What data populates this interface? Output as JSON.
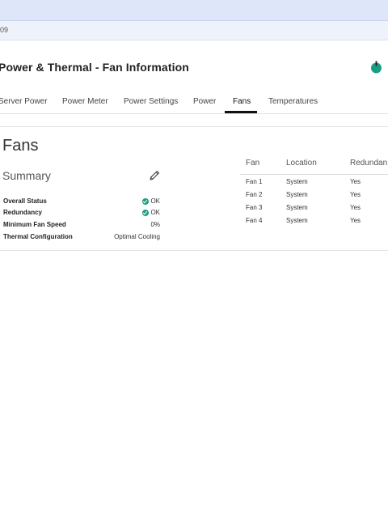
{
  "breadcrumb": {
    "text": "09"
  },
  "page": {
    "title": "Power & Thermal - Fan Information"
  },
  "tabs": [
    {
      "label": "Server Power"
    },
    {
      "label": "Power Meter"
    },
    {
      "label": "Power Settings"
    },
    {
      "label": "Power"
    },
    {
      "label": "Fans",
      "active": true
    },
    {
      "label": "Temperatures"
    }
  ],
  "section": {
    "heading": "Fans"
  },
  "summary": {
    "heading": "Summary",
    "rows": [
      {
        "label": "Overall Status",
        "value": "OK",
        "status_icon": "check-circle-icon"
      },
      {
        "label": "Redundancy",
        "value": "OK",
        "status_icon": "check-circle-icon"
      },
      {
        "label": "Minimum Fan Speed",
        "value": "0%"
      },
      {
        "label": "Thermal Configuration",
        "value": "Optimal Cooling"
      }
    ]
  },
  "fan_table": {
    "headers": [
      "Fan",
      "Location",
      "Redundan"
    ],
    "rows": [
      [
        "Fan 1",
        "System",
        "Yes"
      ],
      [
        "Fan 2",
        "System",
        "Yes"
      ],
      [
        "Fan 3",
        "System",
        "Yes"
      ],
      [
        "Fan 4",
        "System",
        "Yes"
      ]
    ]
  },
  "colors": {
    "accent": "#1a9e83",
    "topbar": "#dde7f9",
    "power_icon": "#1a9e83"
  }
}
